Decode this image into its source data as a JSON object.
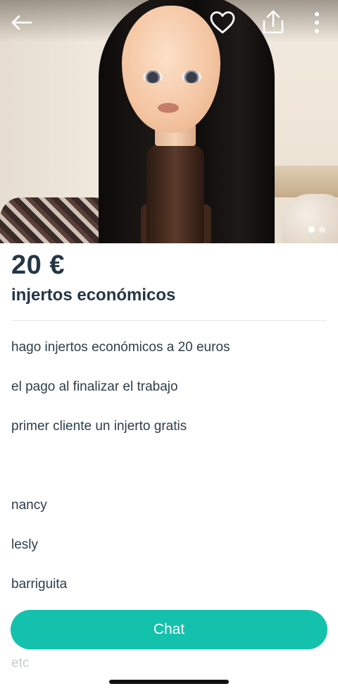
{
  "listing": {
    "price": "20 €",
    "title": "injertos económicos",
    "description": [
      "hago injertos económicos a 20 euros",
      "el pago al finalizar el trabajo",
      "primer cliente un injerto gratis",
      "",
      "nancy",
      "lesly",
      "barriguita",
      "etc"
    ]
  },
  "actions": {
    "chat_label": "Chat"
  },
  "gallery": {
    "image_count": 2,
    "current_index": 1
  },
  "colors": {
    "accent": "#13c1ac",
    "text": "#253645"
  },
  "icons": [
    "back-arrow-icon",
    "heart-icon",
    "share-icon",
    "more-vertical-icon"
  ]
}
